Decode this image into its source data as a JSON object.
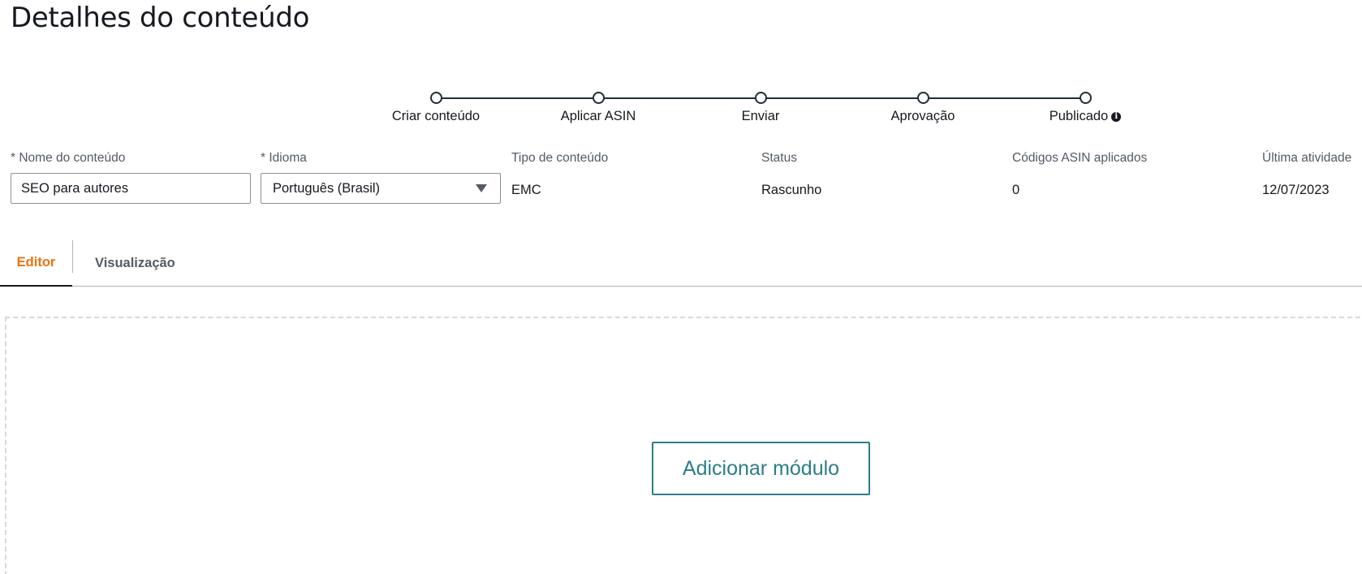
{
  "page": {
    "title": "Detalhes do conteúdo"
  },
  "stepper": {
    "steps": [
      {
        "label": "Criar conteúdo"
      },
      {
        "label": "Aplicar ASIN"
      },
      {
        "label": "Enviar"
      },
      {
        "label": "Aprovação"
      },
      {
        "label": "Publicado"
      }
    ],
    "info_icon_glyph": "i"
  },
  "fields": {
    "content_name": {
      "label": "* Nome do conteúdo",
      "value": "SEO para autores"
    },
    "language": {
      "label": "* Idioma",
      "value": "Português (Brasil)"
    },
    "content_type": {
      "label": "Tipo de conteúdo",
      "value": "EMC"
    },
    "status": {
      "label": "Status",
      "value": "Rascunho"
    },
    "asin_codes": {
      "label": "Códigos ASIN aplicados",
      "value": "0"
    },
    "last_activity": {
      "label": "Última atividade",
      "value": "12/07/2023"
    }
  },
  "tabs": {
    "editor": "Editor",
    "preview": "Visualização"
  },
  "editor": {
    "add_module_label": "Adicionar módulo"
  },
  "colors": {
    "active_tab": "#ec7211",
    "primary_button": "#2c7d8a",
    "stepper": "#1e2f33"
  }
}
